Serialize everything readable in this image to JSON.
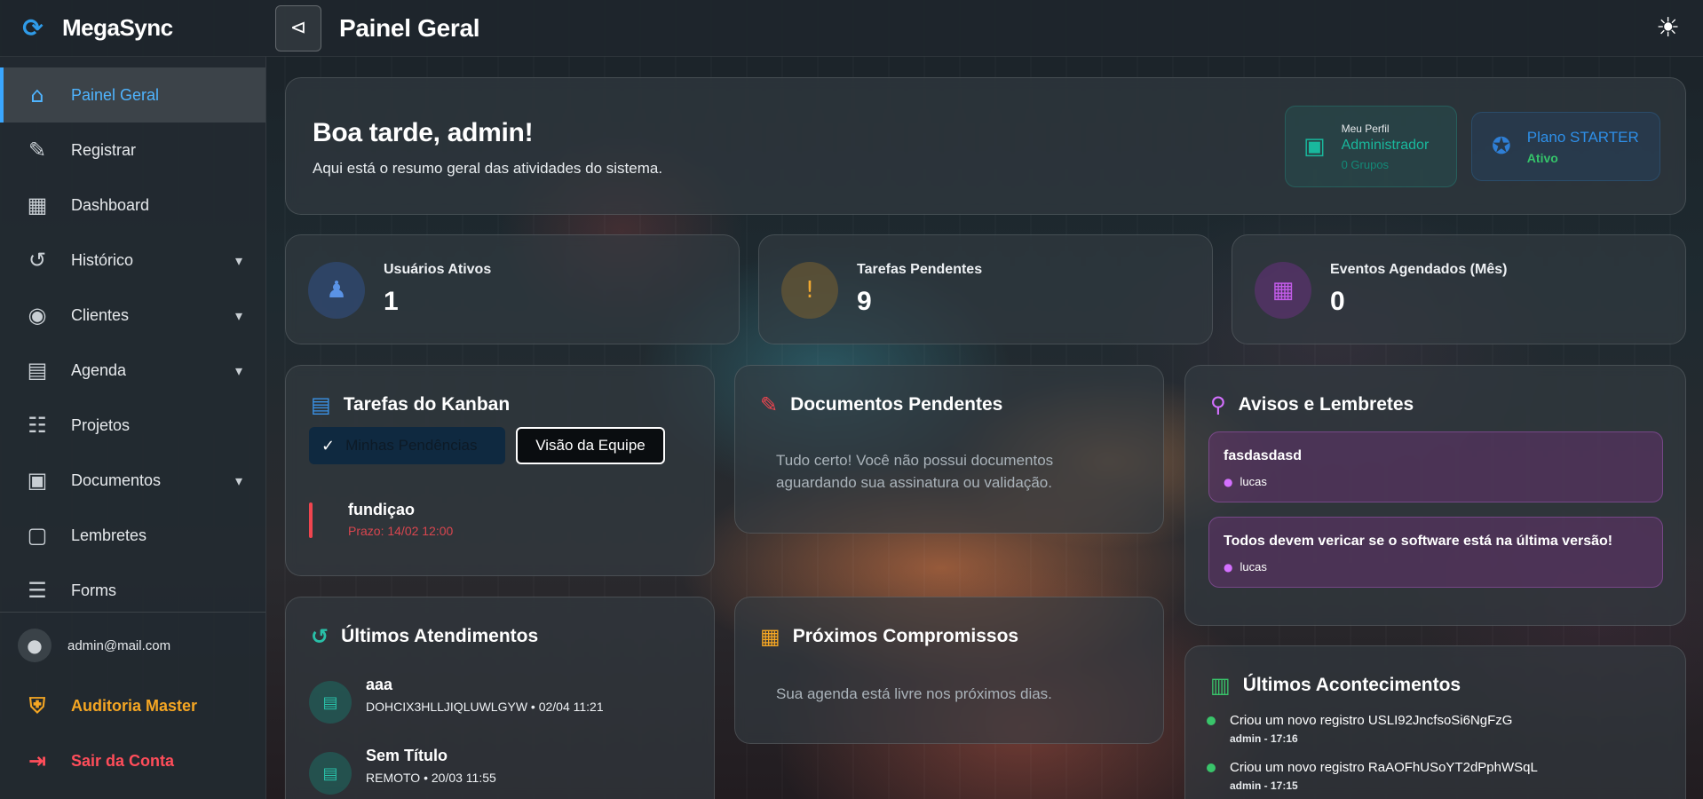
{
  "app": {
    "name": "MegaSync"
  },
  "header": {
    "title": "Painel Geral",
    "menu_toggle_icon": "⊲",
    "theme_icon": "☀"
  },
  "sidebar": {
    "items": [
      {
        "label": "Painel Geral",
        "icon": "home-icon",
        "glyph": "⌂",
        "active": true
      },
      {
        "label": "Registrar",
        "icon": "register-icon",
        "glyph": "✎"
      },
      {
        "label": "Dashboard",
        "icon": "dashboard-icon",
        "glyph": "▦"
      },
      {
        "label": "Histórico",
        "icon": "history-icon",
        "glyph": "↺",
        "expandable": true
      },
      {
        "label": "Clientes",
        "icon": "clients-icon",
        "glyph": "◉",
        "expandable": true
      },
      {
        "label": "Agenda",
        "icon": "calendar-icon",
        "glyph": "▤",
        "expandable": true
      },
      {
        "label": "Projetos",
        "icon": "clipboard-icon",
        "glyph": "☷"
      },
      {
        "label": "Documentos",
        "icon": "folder-icon",
        "glyph": "▣",
        "expandable": true
      },
      {
        "label": "Lembretes",
        "icon": "chat-icon",
        "glyph": "▢"
      },
      {
        "label": "Forms",
        "icon": "forms-icon",
        "glyph": "☰"
      }
    ],
    "user_email": "admin@mail.com",
    "audit_label": "Auditoria Master",
    "logout_label": "Sair da Conta"
  },
  "welcome": {
    "greeting": "Boa tarde, admin!",
    "subtitle": "Aqui está o resumo geral das atividades do sistema.",
    "profile": {
      "small": "Meu Perfil",
      "role": "Administrador",
      "groups": "0 Grupos"
    },
    "plan": {
      "name": "Plano STARTER",
      "status": "Ativo"
    }
  },
  "stats": [
    {
      "label": "Usuários Ativos",
      "value": "1",
      "icon": "users-icon",
      "glyph": "♟"
    },
    {
      "label": "Tarefas Pendentes",
      "value": "9",
      "icon": "alert-clipboard-icon",
      "glyph": "!"
    },
    {
      "label": "Eventos Agendados (Mês)",
      "value": "0",
      "icon": "calendar-icon",
      "glyph": "▦"
    }
  ],
  "kanban": {
    "title": "Tarefas do Kanban",
    "tab_mine": "Minhas Pendências",
    "tab_team": "Visão da Equipe",
    "tasks": [
      {
        "name": "fundiçao",
        "due": "Prazo: 14/02 12:00"
      }
    ]
  },
  "documents": {
    "title": "Documentos Pendentes",
    "empty": "Tudo certo! Você não possui documentos aguardando sua assinatura ou validação."
  },
  "notices": {
    "title": "Avisos e Lembretes",
    "items": [
      {
        "title": "fasdasdasd",
        "user": "lucas"
      },
      {
        "title": "Todos devem vericar se o software está na última versão!",
        "user": "lucas"
      }
    ]
  },
  "attendances": {
    "title": "Últimos Atendimentos",
    "items": [
      {
        "name": "aaa",
        "meta": "DOHCIX3HLLJIQLUWLGYW • 02/04 11:21"
      },
      {
        "name": "Sem Título",
        "meta": "REMOTO • 20/03 11:55"
      }
    ]
  },
  "appointments": {
    "title": "Próximos Compromissos",
    "empty": "Sua agenda está livre nos próximos dias."
  },
  "events": {
    "title": "Últimos Acontecimentos",
    "items": [
      {
        "text": "Criou um novo registro USLI92JncfsoSi6NgFzG",
        "meta": "admin - 17:16"
      },
      {
        "text": "Criou um novo registro RaAOFhUSoYT2dPphWSqL",
        "meta": "admin - 17:15"
      }
    ]
  },
  "colors": {
    "accent_blue": "#3aa7ff",
    "teal": "#19b89d",
    "orange": "#f5a623",
    "red": "#ff4d5a",
    "purple": "#c35cea",
    "green": "#39c46a"
  }
}
